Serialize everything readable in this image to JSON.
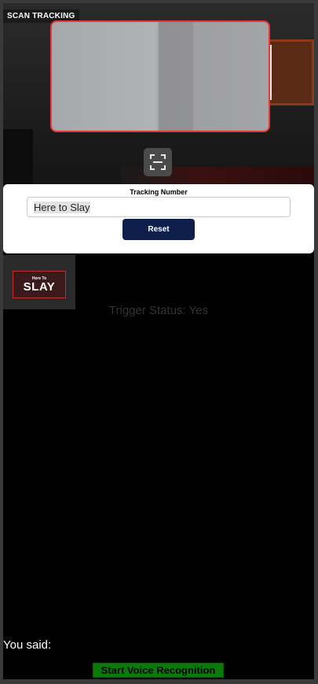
{
  "camera": {
    "badge": "SCAN TRACKING",
    "scan_icon": "scan-frame-icon",
    "scan_box_color": "#e53935"
  },
  "tracking": {
    "title": "Tracking Number",
    "value": "Here to Slay",
    "reset_label": "Reset",
    "reset_color": "#0d1f4a"
  },
  "thumbnail": {
    "small_text": "Here To",
    "big_text": "SLAY"
  },
  "status": {
    "trigger_text": "Trigger Status: Yes"
  },
  "voice": {
    "you_said_label": "You said:",
    "button_label": "Start Voice Recognition",
    "button_color": "#0a7a0a"
  }
}
